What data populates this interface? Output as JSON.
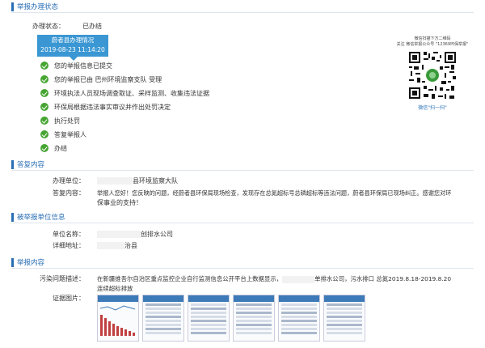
{
  "sections": {
    "status_title": "举报办理状态",
    "reply_title": "答复内容",
    "reported_title": "被举报单位信息",
    "content_title": "举报内容"
  },
  "status": {
    "label": "办理状态：",
    "value": "已办结",
    "badge_title": "蔚者县办理情况",
    "badge_date": "2019-08-23 11:14:20",
    "steps": [
      "您的举报信息已提交",
      "您的举报已由 巴州环境监察支队 受理",
      "环境执法人员现场调查取证、采样监测、收集违法证据",
      "环保局根据违法事实审议并作出处罚决定",
      "执行处罚",
      "答复举报人",
      "办结"
    ]
  },
  "qr": {
    "caption1": "微信扫描下方二维码",
    "caption2": "关注 微信举报公众号 \"12369环保举报\"",
    "scan_label": "微信\"扫一扫\""
  },
  "reply": {
    "unit_label": "办理单位：",
    "unit_value": "县环境监察大队",
    "content_label": "答复内容：",
    "content_line1": "举报人您好！您反映的问题，经蔚者县环保局现场检查，发现存在总氮超标号总磷超标等违法问题，蔚者县环保局已现场纠正。感谢您对环",
    "content_line2": "保事业的支持！"
  },
  "reported": {
    "name_label": "单位名称：",
    "name_value": "创排水公司",
    "address_label": "详细地址：",
    "address_value": "治县"
  },
  "content": {
    "desc_label": "污染问题描述：",
    "desc_line1a": "在新疆维吾尔自治区重点监控企业自行监测信息公开平台上数据显示，",
    "desc_line1b": "单排水公司，污水排口 总氮2019.8.18-2019.8.20",
    "desc_line2": "连续超标排放",
    "photos_label": "证据图片："
  }
}
